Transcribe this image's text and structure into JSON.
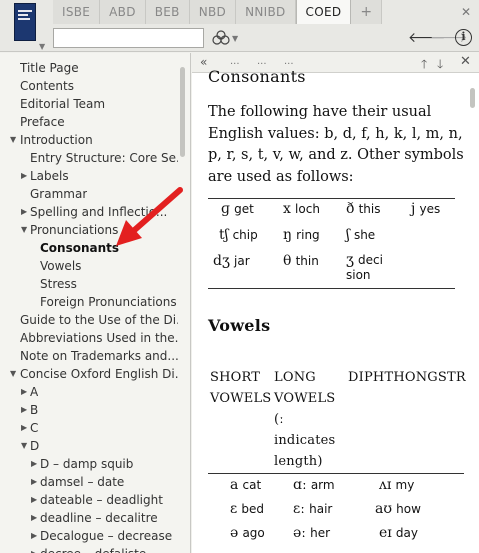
{
  "tabs": [
    {
      "label": "ISBE"
    },
    {
      "label": "ABD"
    },
    {
      "label": "BEB"
    },
    {
      "label": "NBD"
    },
    {
      "label": "NNIBD"
    },
    {
      "label": "COED"
    },
    {
      "label": "+"
    }
  ],
  "toolbar": {
    "close_glyph": "✕",
    "search_value": "",
    "back_glyph": "🡐",
    "forward_glyph": "🡒",
    "info_glyph": "i"
  },
  "sidebar": {
    "items": [
      {
        "label": "Title Page"
      },
      {
        "label": "Contents"
      },
      {
        "label": "Editorial Team"
      },
      {
        "label": "Preface"
      },
      {
        "label": "Introduction"
      },
      {
        "label": "Entry Structure: Core Se..."
      },
      {
        "label": "Labels"
      },
      {
        "label": "Grammar"
      },
      {
        "label": "Spelling and Inflectio..."
      },
      {
        "label": "Pronunciations"
      },
      {
        "label": "Consonants"
      },
      {
        "label": "Vowels"
      },
      {
        "label": "Stress"
      },
      {
        "label": "Foreign Pronunciations"
      },
      {
        "label": "Guide to the Use of the Di..."
      },
      {
        "label": "Abbreviations Used in the..."
      },
      {
        "label": "Note on Trademarks and..."
      },
      {
        "label": "Concise Oxford English Di..."
      },
      {
        "label": "A"
      },
      {
        "label": "B"
      },
      {
        "label": "C"
      },
      {
        "label": "D"
      },
      {
        "label": "D – damp squib"
      },
      {
        "label": "damsel – date"
      },
      {
        "label": "dateable – deadlight"
      },
      {
        "label": "deadline – decalitre"
      },
      {
        "label": "Decalogue – decrease"
      },
      {
        "label": "decree – defaliste"
      }
    ]
  },
  "content_toolbar": {
    "collapse_glyph": "«",
    "crumbs": [
      "...",
      "...",
      "..."
    ],
    "up_glyph": "🡑",
    "down_glyph": "🡓",
    "close_glyph": "✕"
  },
  "article": {
    "consonants_heading": "Consonants",
    "intro": "The following have their usual English values: b, d, f, h, k, l, m, n, p, r, s, t, v, w, and z. Other symbols are used as follows:",
    "consonants": [
      {
        "sym": "ɡ",
        "ex": "get"
      },
      {
        "sym": "x",
        "ex": "loch"
      },
      {
        "sym": "ð",
        "ex": "this"
      },
      {
        "sym": "j",
        "ex": "yes"
      },
      {
        "sym": "tʃ",
        "ex": "chip"
      },
      {
        "sym": "ŋ",
        "ex": "ring"
      },
      {
        "sym": "ʃ",
        "ex": "she"
      },
      {
        "sym": "dʒ",
        "ex": "jar"
      },
      {
        "sym": "θ",
        "ex": "thin"
      },
      {
        "sym": "ʒ",
        "ex": "deci sion"
      }
    ],
    "vowels_heading": "Vowels",
    "vowel_columns": [
      "SHORT VOWELS",
      "LONG VOWELS (ː indicates length)",
      "DIPHTHONGS",
      "TR"
    ],
    "vowels": [
      {
        "short_sym": "a",
        "short_ex": "cat",
        "long_sym": "ɑː",
        "long_ex": "arm",
        "diph_sym": "ʌɪ",
        "diph_ex": "my"
      },
      {
        "short_sym": "ɛ",
        "short_ex": "bed",
        "long_sym": "ɛː",
        "long_ex": "hair",
        "diph_sym": "aʊ",
        "diph_ex": "how"
      },
      {
        "short_sym": "ə",
        "short_ex": "ago",
        "long_sym": "əː",
        "long_ex": "her",
        "diph_sym": "eɪ",
        "diph_ex": "day"
      }
    ]
  }
}
